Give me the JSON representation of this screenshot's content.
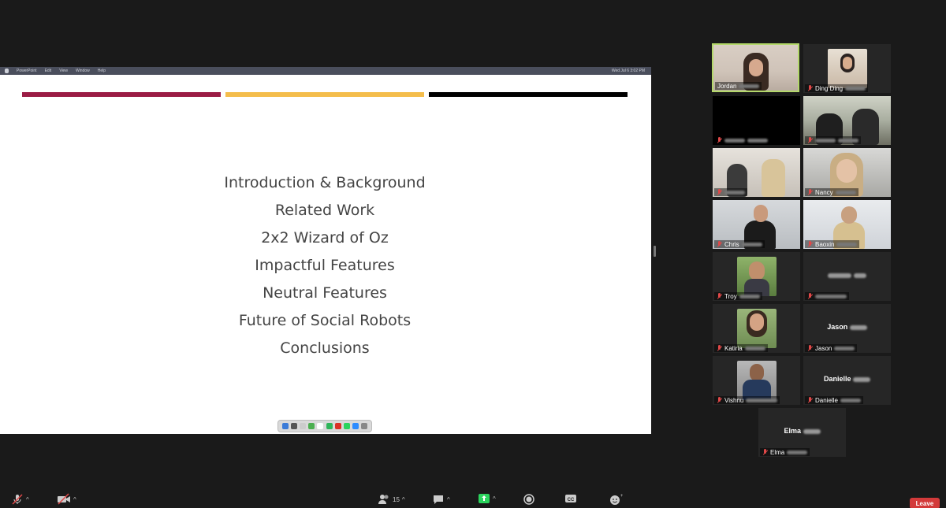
{
  "menubar": {
    "items": [
      "PowerPoint",
      "Edit",
      "View",
      "Window",
      "Help"
    ],
    "clock": "Wed Jul 6  3:02 PM"
  },
  "slide": {
    "bar_colors": [
      "#9b1c45",
      "#f4bd4c",
      "#000000"
    ],
    "agenda": [
      "Introduction & Background",
      "Related Work",
      "2x2 Wizard of Oz",
      "Impactful Features",
      "Neutral Features",
      "Future of Social Robots",
      "Conclusions"
    ]
  },
  "participants": [
    {
      "name": "Jordan",
      "video": true,
      "active": true,
      "muted": false
    },
    {
      "name": "Ding Ding",
      "video": true,
      "photo": true,
      "muted": true
    },
    {
      "name": "",
      "video": true,
      "muted": true
    },
    {
      "name": "",
      "video": true,
      "muted": true
    },
    {
      "name": "",
      "video": true,
      "muted": true
    },
    {
      "name": "Nancy",
      "video": true,
      "muted": true
    },
    {
      "name": "Chris",
      "video": true,
      "muted": true
    },
    {
      "name": "Baoxin",
      "video": true,
      "muted": true
    },
    {
      "name": "Troy",
      "video": true,
      "photo": true,
      "muted": true
    },
    {
      "name": "",
      "video": false,
      "muted": true
    },
    {
      "name": "Katiria",
      "video": true,
      "photo": true,
      "muted": true
    },
    {
      "name": "Jason",
      "video": false,
      "display_name": "Jason",
      "muted": true
    },
    {
      "name": "Vishnu",
      "video": true,
      "photo": true,
      "muted": true
    },
    {
      "name": "Danielle",
      "video": false,
      "display_name": "Danielle",
      "muted": true
    },
    {
      "name": "Elma",
      "video": false,
      "display_name": "Elma",
      "muted": true
    }
  ],
  "toolbar": {
    "participants_count": "15",
    "leave_label": "Leave"
  },
  "colors": {
    "background": "#1a1a1a",
    "active_speaker": "#b4d86b",
    "leave": "#d33a3a",
    "share_green": "#2bd45d"
  }
}
